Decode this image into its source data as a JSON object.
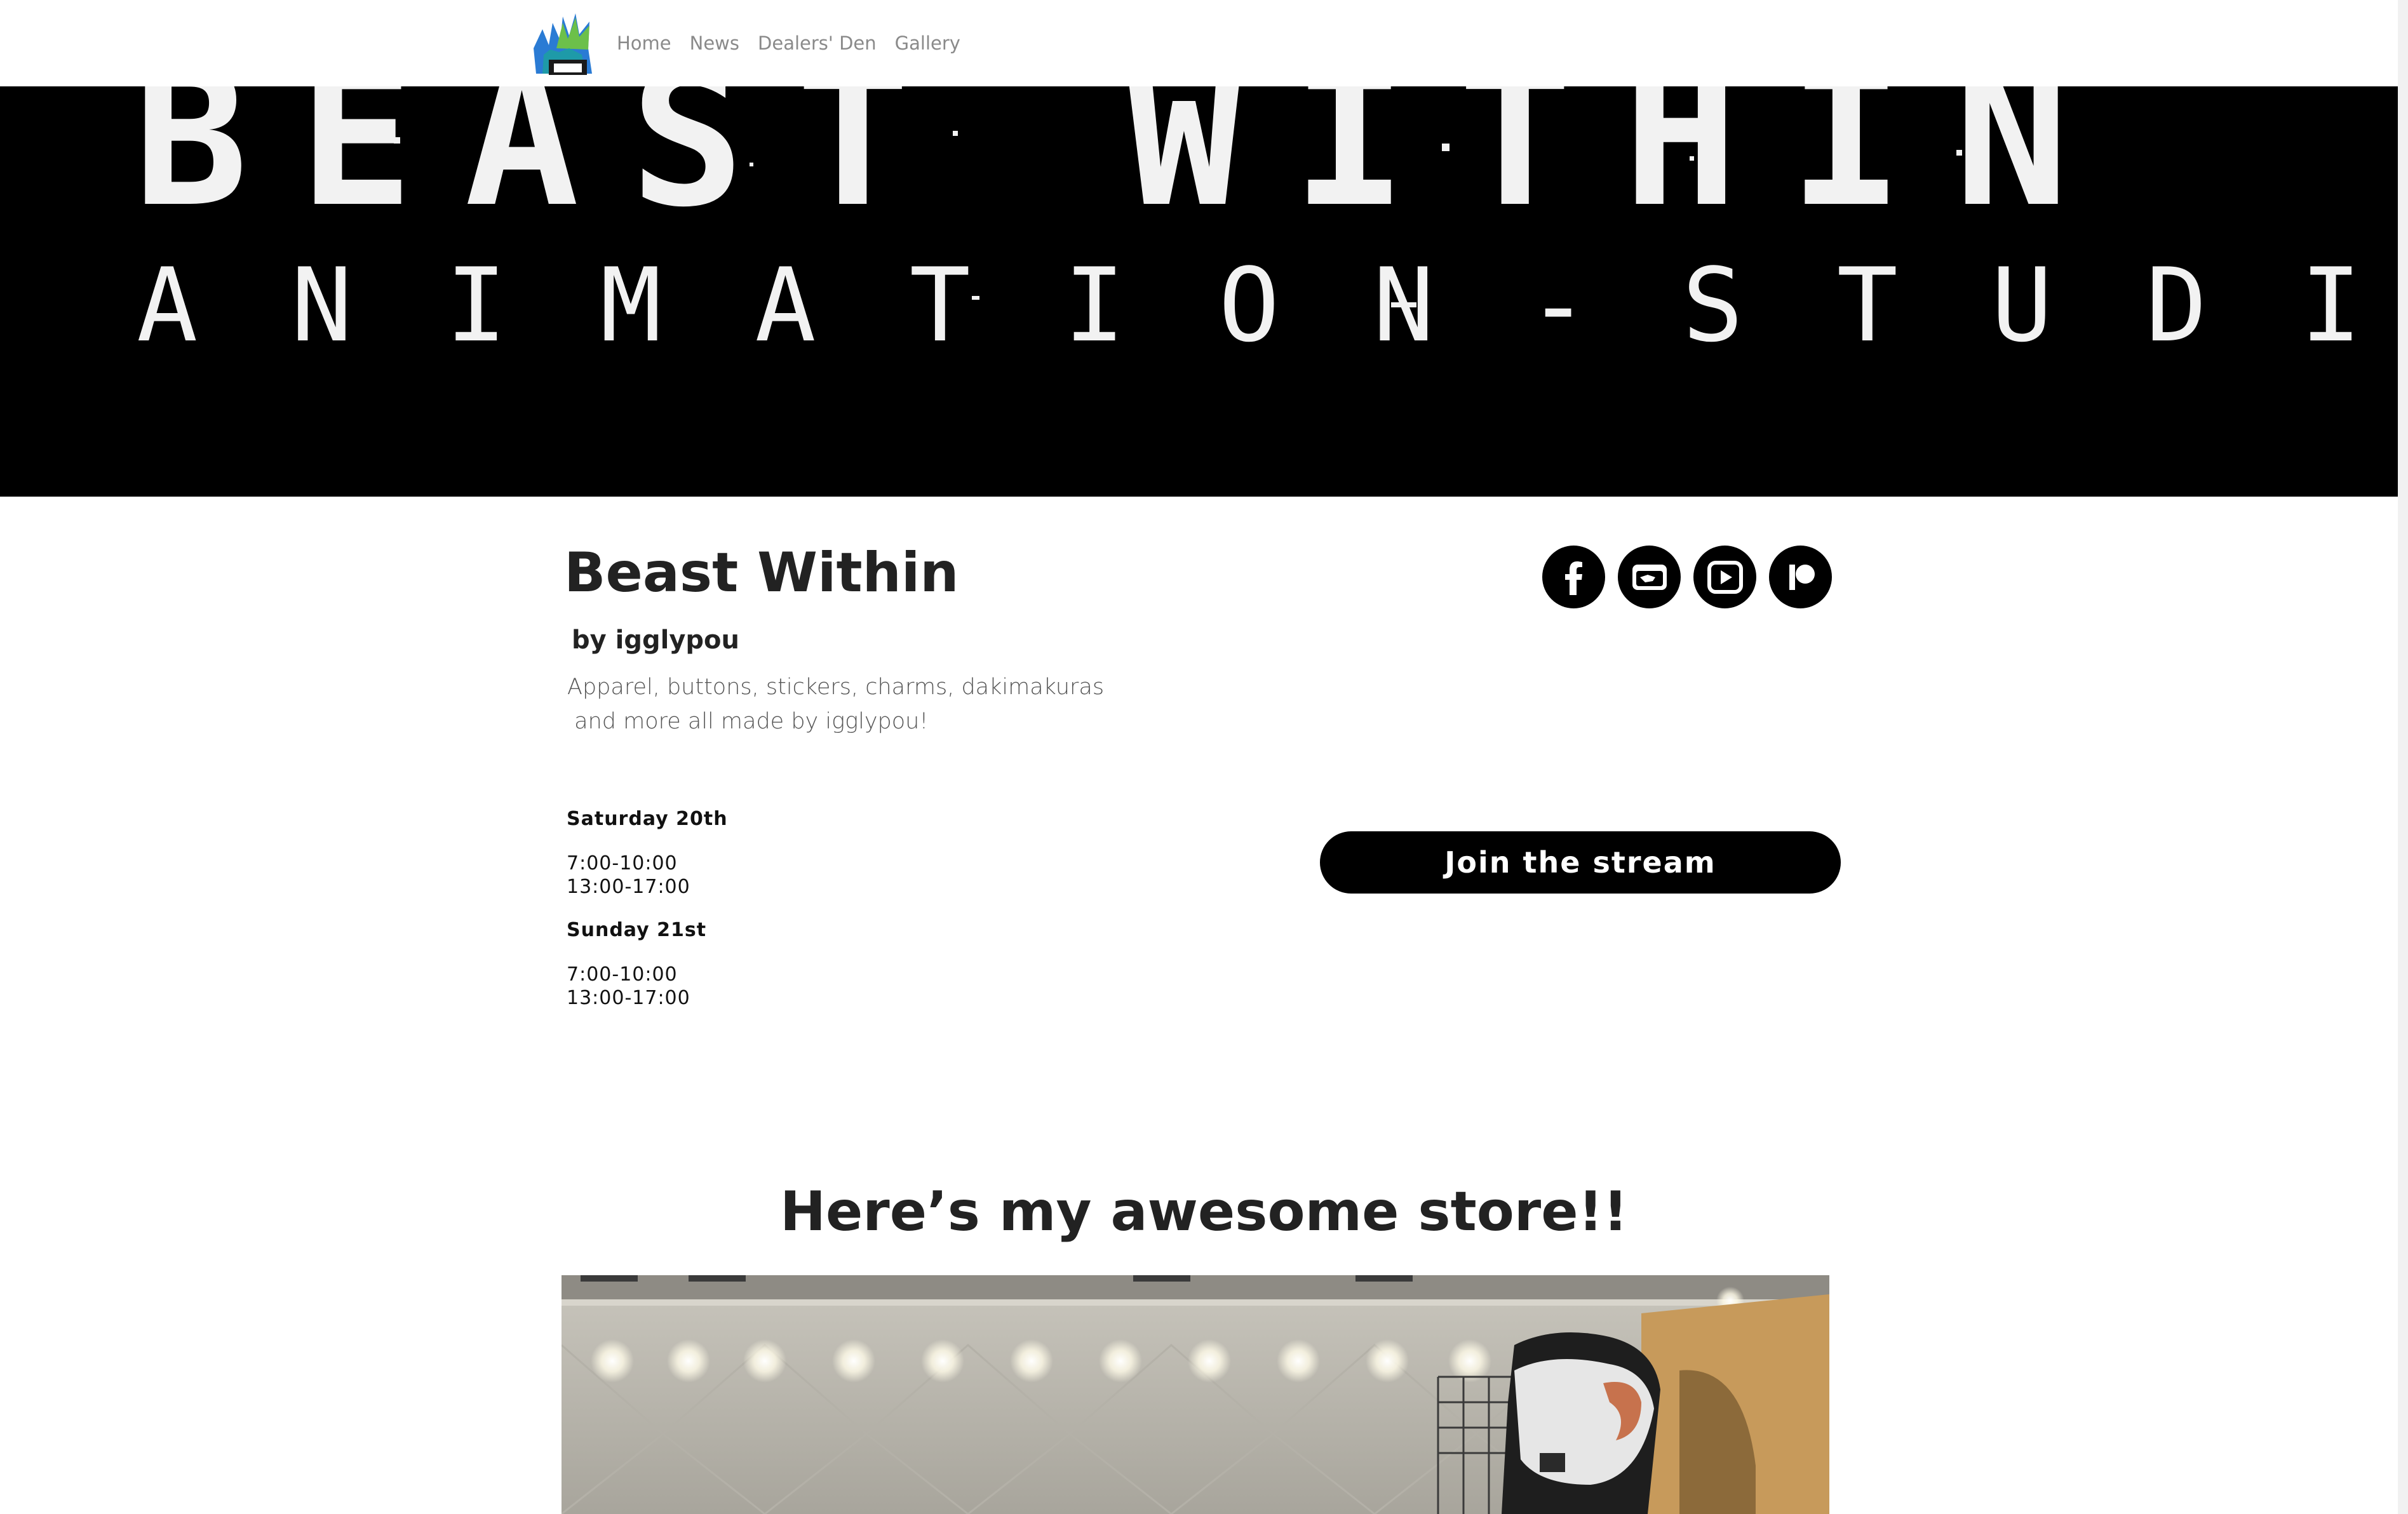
{
  "nav": {
    "logo_icon": "beast-within-logo-icon",
    "links": [
      "Home",
      "News",
      "Dealers' Den",
      "Gallery"
    ]
  },
  "banner": {
    "line1": "BEAST WITHIN",
    "line2": "ANIMATION-STUDIO"
  },
  "vendor": {
    "title": "Beast Within",
    "byline": "by igglypou",
    "description_lines": [
      "Apparel, buttons, stickers, charms, dakimakuras",
      " and more all made by igglypou!"
    ]
  },
  "socials": [
    {
      "icon": "facebook-icon"
    },
    {
      "icon": "furaffinity-icon"
    },
    {
      "icon": "video-play-icon"
    },
    {
      "icon": "patreon-icon"
    }
  ],
  "schedule": [
    {
      "day": "Saturday 20th",
      "slots": [
        "7:00-10:00",
        "13:00-17:00"
      ]
    },
    {
      "day": "Sunday 21st",
      "slots": [
        "7:00-10:00",
        "13:00-17:00"
      ]
    }
  ],
  "stream_button": "Join the stream",
  "store": {
    "heading": "Here’s my awesome store!!"
  },
  "colors": {
    "banner_bg": "#000000",
    "text": "#222222",
    "nav_link": "#8a8a8a",
    "button_bg": "#000000",
    "button_text": "#ffffff"
  }
}
